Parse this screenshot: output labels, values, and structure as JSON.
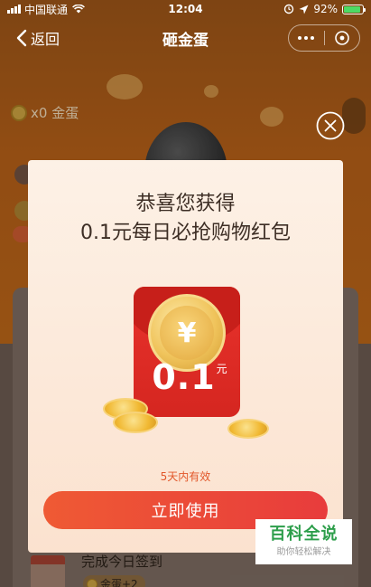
{
  "status_bar": {
    "carrier": "中国联通",
    "time": "12:04",
    "battery_percent": "92%",
    "battery_level": 0.92
  },
  "nav": {
    "back_label": "返回",
    "title": "砸金蛋"
  },
  "background": {
    "coin_count": "x0 金蛋",
    "task_name": "完成今日签到",
    "task_reward": "金蛋+2"
  },
  "popup": {
    "title": "恭喜您获得",
    "subtitle": "0.1元每日必抢购物红包",
    "coin_symbol": "¥",
    "amount": "0.1",
    "amount_unit": "元",
    "validity": "5天内有效",
    "button_label": "立即使用"
  },
  "watermark": {
    "title": "百科全说",
    "subtitle": "助你轻松解决"
  },
  "colors": {
    "button_gradient_start": "#ef5a34",
    "button_gradient_end": "#e83c3c",
    "envelope_red": "#d52620",
    "validity_text": "#e2572a",
    "watermark_green": "#2d9e4b"
  },
  "icons": [
    "signal-icon",
    "wifi-icon",
    "location-icon",
    "alarm-icon",
    "battery-icon",
    "back-chevron-icon",
    "more-icon",
    "close-miniprogram-icon",
    "close-icon",
    "yuan-coin-icon"
  ]
}
